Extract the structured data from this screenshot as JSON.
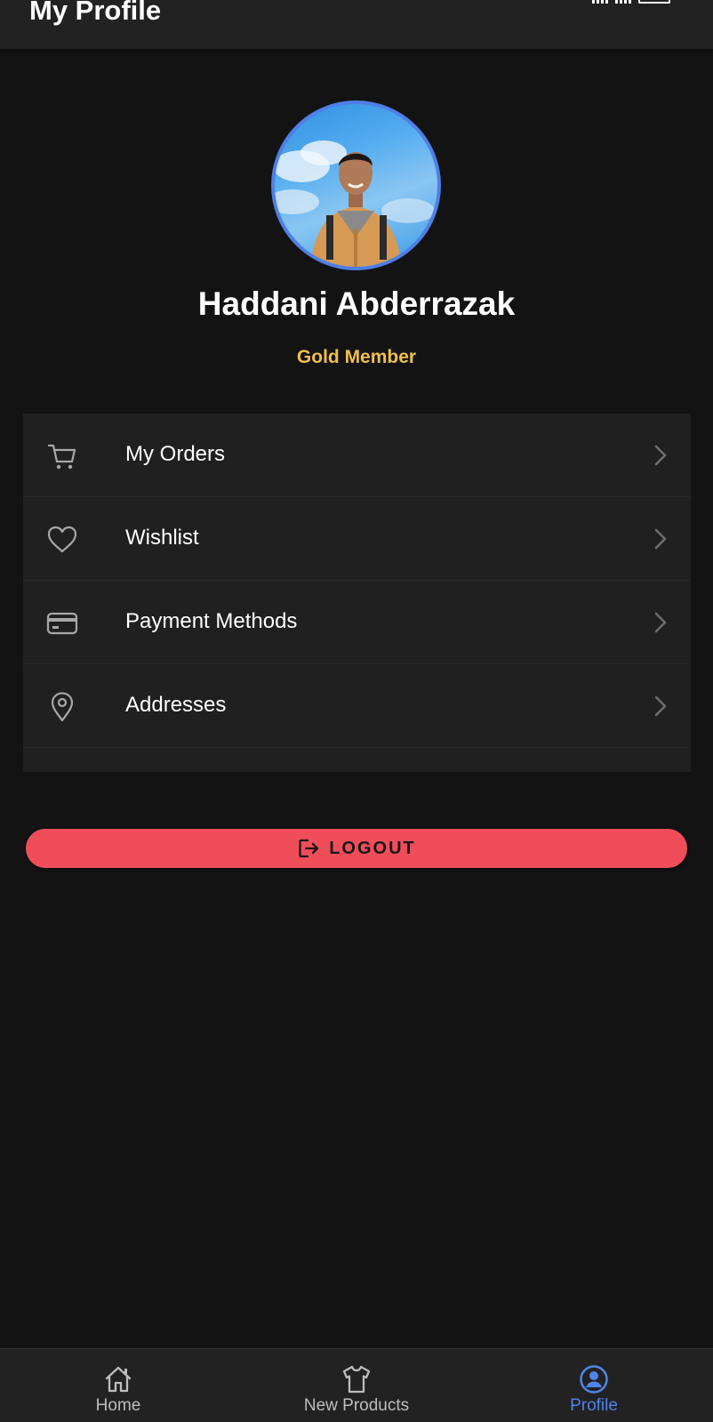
{
  "header": {
    "title": "My Profile"
  },
  "profile": {
    "name": "Haddani Abderrazak",
    "membership": "Gold Member",
    "avatar_icon": "user-photo",
    "avatar_border_color": "#4f7fe6",
    "membership_color": "#f0bf4c"
  },
  "menu": {
    "items": [
      {
        "label": "My Orders",
        "icon": "cart-icon"
      },
      {
        "label": "Wishlist",
        "icon": "heart-icon"
      },
      {
        "label": "Payment Methods",
        "icon": "credit-card-icon"
      },
      {
        "label": "Addresses",
        "icon": "location-pin-icon"
      }
    ]
  },
  "logout": {
    "label": "LOGOUT",
    "color": "#f04d5b",
    "icon": "logout-icon"
  },
  "bottom_nav": {
    "items": [
      {
        "label": "Home",
        "icon": "home-icon",
        "active": false
      },
      {
        "label": "New Products",
        "icon": "tshirt-icon",
        "active": false
      },
      {
        "label": "Profile",
        "icon": "profile-icon",
        "active": true
      }
    ],
    "active_color": "#4f84e8"
  }
}
